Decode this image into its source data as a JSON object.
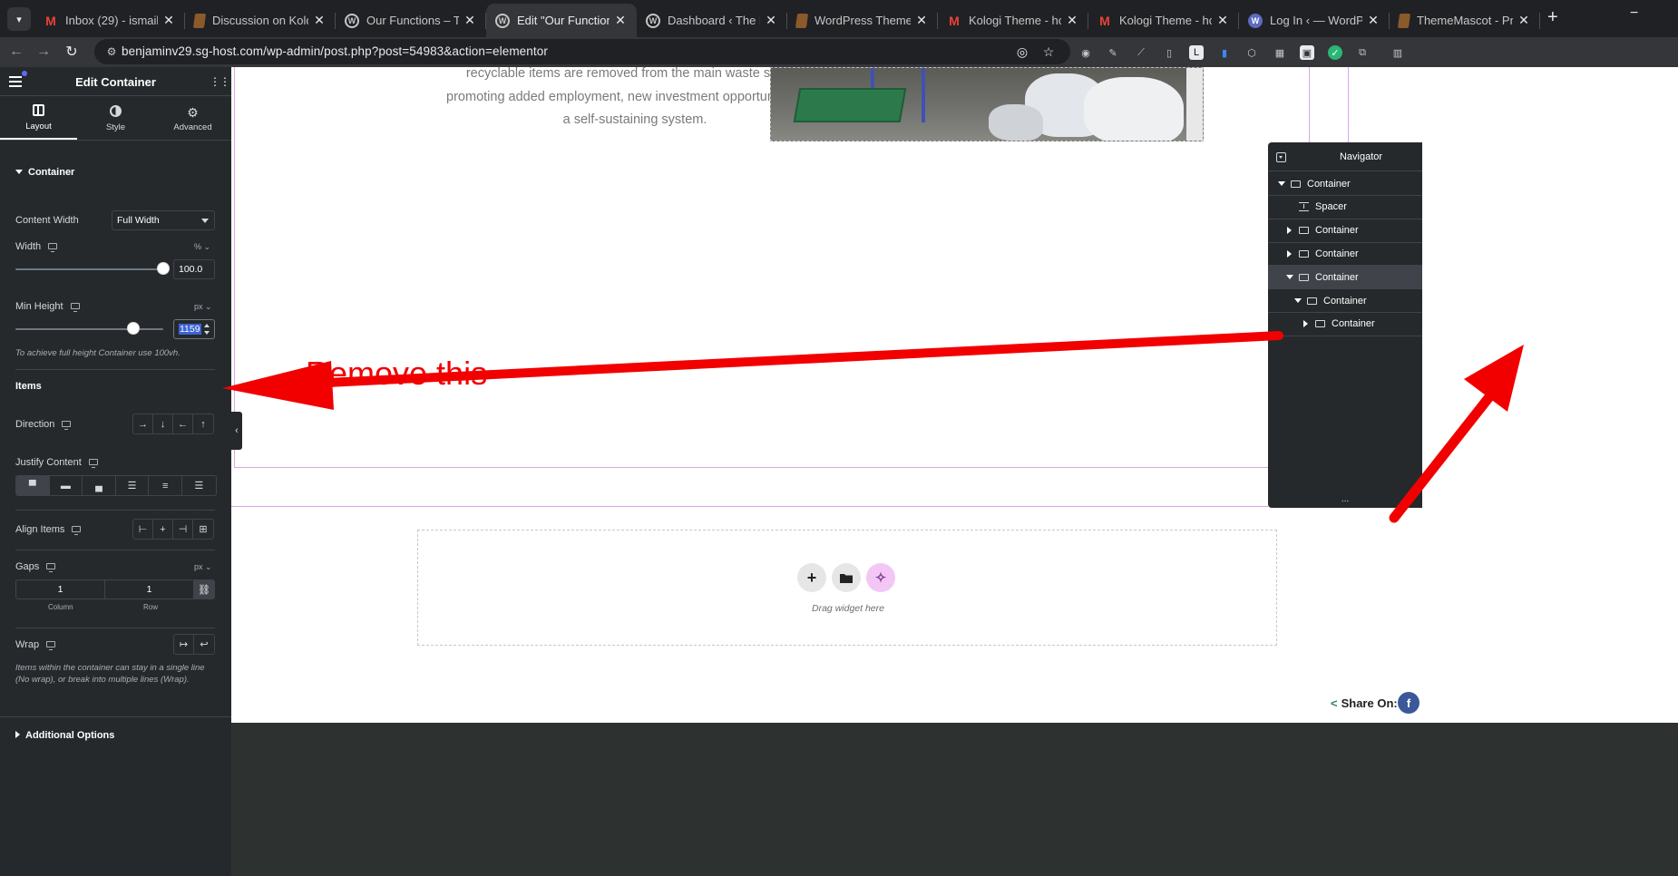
{
  "browser": {
    "tabs": [
      {
        "title": "Inbox (29) - ismail",
        "icon": "gmail-icon",
        "fav": "M",
        "fav_class": "fav-gmail",
        "active": false
      },
      {
        "title": "Discussion on Kologi",
        "icon": "document-icon",
        "fav": "",
        "fav_class": "fav-doc",
        "active": false
      },
      {
        "title": "Our Functions – The",
        "icon": "wordpress-icon",
        "fav": "W",
        "fav_class": "fav-wp",
        "active": false
      },
      {
        "title": "Edit \"Our Functions\"",
        "icon": "wordpress-icon",
        "fav": "W",
        "fav_class": "fav-wp",
        "active": true
      },
      {
        "title": "Dashboard ‹ The Eco",
        "icon": "wordpress-icon",
        "fav": "W",
        "fav_class": "fav-wp",
        "active": false
      },
      {
        "title": "WordPress Theme",
        "icon": "document-icon",
        "fav": "",
        "fav_class": "fav-doc",
        "active": false
      },
      {
        "title": "Kologi Theme - how",
        "icon": "gmail-icon",
        "fav": "M",
        "fav_class": "fav-gmail",
        "active": false
      },
      {
        "title": "Kologi Theme - how",
        "icon": "gmail-icon",
        "fav": "M",
        "fav_class": "fav-gmail",
        "active": false
      },
      {
        "title": "Log In ‹ — WordPress",
        "icon": "login-icon",
        "fav": "W",
        "fav_class": "fav-blue",
        "active": false
      },
      {
        "title": "ThemeMascot - Pro",
        "icon": "document-icon",
        "fav": "",
        "fav_class": "fav-doc",
        "active": false
      }
    ],
    "tab_close_glyph": "✕",
    "new_tab_glyph": "+",
    "url": "benjaminv29.sg-host.com/wp-admin/post.php?post=54983&action=elementor"
  },
  "panel": {
    "title": "Edit Container",
    "tabs": [
      {
        "label": "Layout",
        "icon": "layout-icon",
        "active": true
      },
      {
        "label": "Style",
        "icon": "style-icon",
        "active": false
      },
      {
        "label": "Advanced",
        "icon": "gear-icon",
        "active": false
      }
    ],
    "section_title": "Container",
    "content_width": {
      "label": "Content Width",
      "value": "Full Width"
    },
    "width": {
      "label": "Width",
      "unit": "%",
      "value": "100.0",
      "fraction": 1.0
    },
    "min_height": {
      "label": "Min Height",
      "unit": "px",
      "value": "1159",
      "fraction": 0.8
    },
    "min_height_help": "To achieve full height Container use 100vh.",
    "items_title": "Items",
    "direction_label": "Direction",
    "direction_glyphs": [
      "→",
      "↓",
      "←",
      "↑"
    ],
    "justify_label": "Justify Content",
    "align_label": "Align Items",
    "gaps": {
      "label": "Gaps",
      "unit": "px",
      "column": "1",
      "row": "1",
      "column_label": "Column",
      "row_label": "Row"
    },
    "wrap_label": "Wrap",
    "wrap_help": "Items within the container can stay in a single line (No wrap), or break into multiple lines (Wrap).",
    "additional_options": "Additional Options"
  },
  "canvas": {
    "body_lines": [
      "recyclable items are removed from the main waste stream",
      "promoting added employment, new investment opportunities and",
      "a self-sustaining system."
    ],
    "annotation": "Remove this",
    "dropzone_label": "Drag widget here",
    "share_label": "Share On:",
    "fb_glyph": "f"
  },
  "navigator": {
    "title": "Navigator",
    "footer": "...",
    "items": [
      {
        "label": "Container",
        "caret": "down",
        "type": "container",
        "level": 0,
        "selected": false
      },
      {
        "label": "Spacer",
        "caret": "none",
        "type": "spacer",
        "level": 1,
        "selected": false
      },
      {
        "label": "Container",
        "caret": "right",
        "type": "container",
        "level": 1,
        "selected": false
      },
      {
        "label": "Container",
        "caret": "right",
        "type": "container",
        "level": 1,
        "selected": false
      },
      {
        "label": "Container",
        "caret": "down",
        "type": "container",
        "level": 1,
        "selected": true
      },
      {
        "label": "Container",
        "caret": "down",
        "type": "container",
        "level": 2,
        "selected": false
      },
      {
        "label": "Container",
        "caret": "right",
        "type": "container",
        "level": 3,
        "selected": false
      }
    ]
  },
  "colors": {
    "annotation_red": "#f20000",
    "panel_bg": "#26292c",
    "outline_purple": "#d9a6e8"
  }
}
